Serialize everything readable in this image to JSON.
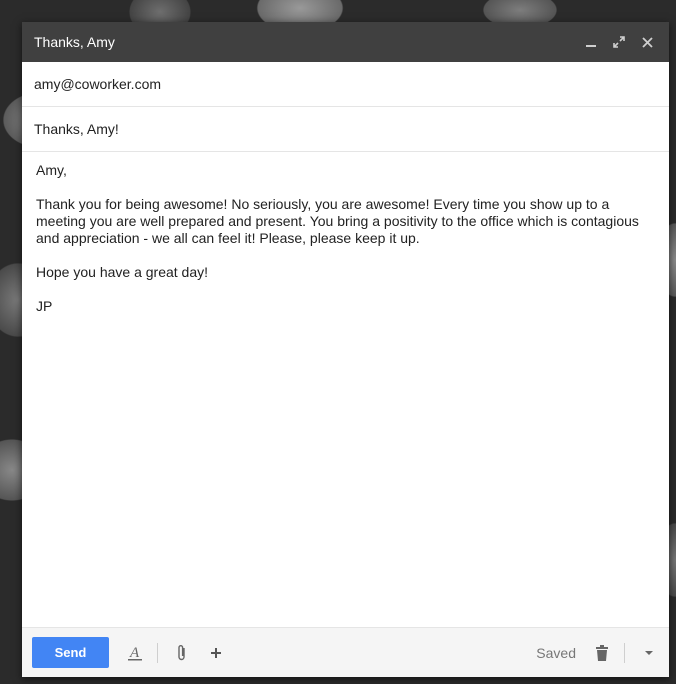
{
  "window": {
    "title": "Thanks, Amy",
    "minimize_icon": "minimize-icon",
    "expand_icon": "expand-icon",
    "close_icon": "close-icon"
  },
  "to": "amy@coworker.com",
  "subject": "Thanks, Amy!",
  "body": {
    "greeting": "Amy,",
    "paragraph": "Thank you for being awesome! No seriously, you are awesome! Every time you show up to a meeting you are well prepared and present. You bring a positivity to the office which is contagious and appreciation - we all can feel it! Please, please keep it up.",
    "closing": "Hope you have a great day!",
    "signature": "JP"
  },
  "toolbar": {
    "send_label": "Send",
    "saved_label": "Saved",
    "send_color": "#4285f4"
  }
}
